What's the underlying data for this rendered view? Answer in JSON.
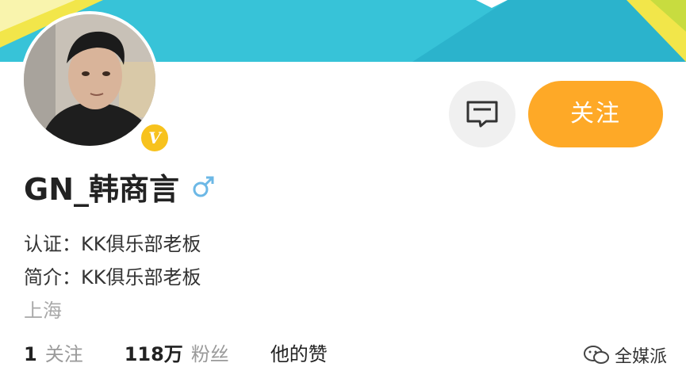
{
  "header": {
    "banner_colors": [
      "#37c3d8",
      "#2bb3cc",
      "#f2e64a",
      "#ffffff"
    ]
  },
  "profile": {
    "avatar_icon": "avatar",
    "verified_badge": "V",
    "username": "GN_韩商言",
    "gender_icon": "male-symbol-icon",
    "verification": "认证：KK俱乐部老板",
    "bio": "简介：KK俱乐部老板",
    "location": "上海"
  },
  "actions": {
    "message_icon": "message-icon",
    "follow_label": "关注"
  },
  "stats": {
    "following_count": "1",
    "following_label": "关注",
    "followers_count": "118万",
    "followers_label": "粉丝",
    "likes_label": "他的赞"
  },
  "watermark": {
    "icon": "wechat-icon",
    "text": "全媒派"
  },
  "colors": {
    "accent": "#fea927",
    "verified": "#f7c21d",
    "gender": "#6cb8e6"
  }
}
